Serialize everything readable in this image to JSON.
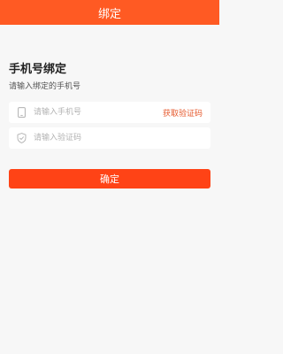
{
  "header": {
    "title": "绑定"
  },
  "main": {
    "title": "手机号绑定",
    "subtitle": "请输入绑定的手机号",
    "phone_field": {
      "placeholder": "请输入手机号",
      "value": "",
      "icon": "phone-icon"
    },
    "get_code_label": "获取验证码",
    "code_field": {
      "placeholder": "请输入验证码",
      "value": "",
      "icon": "shield-check-icon"
    },
    "confirm_label": "确定"
  },
  "colors": {
    "accent": "#ff5a23",
    "button": "#ff4316",
    "link": "#e65a2e",
    "background": "#f7f7f7"
  }
}
